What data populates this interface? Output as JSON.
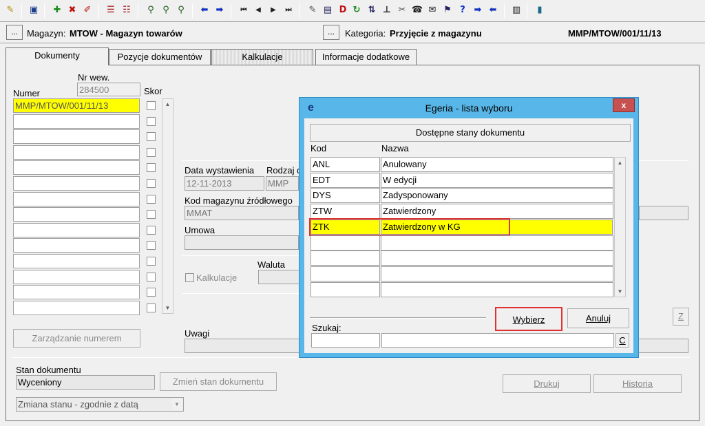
{
  "toolbar": {
    "icons": [
      "pin-icon",
      "save-icon",
      "add-icon",
      "delete-icon",
      "eraser-icon",
      "split-icon",
      "split2-icon",
      "binoculars-icon",
      "binoculars-next-icon",
      "binoculars-special-icon",
      "arrow-left-icon",
      "arrow-right-icon",
      "first-icon",
      "prev-icon",
      "next-icon",
      "last-icon",
      "edit-icon",
      "doc-icon",
      "doc-red-icon",
      "refresh-icon",
      "sort-icon",
      "tree-icon",
      "tools-icon",
      "phone-icon",
      "mail-icon",
      "filter-icon",
      "help-icon",
      "forward-icon",
      "back-icon",
      "report-icon",
      "exit-icon"
    ]
  },
  "header": {
    "magazyn_label": "Magazyn:",
    "magazyn_value": "MTOW - Magazyn towarów",
    "kategoria_label": "Kategoria:",
    "kategoria_value": "Przyjęcie z magazynu",
    "doc_number": "MMP/MTOW/001/11/13",
    "ellipsis": "..."
  },
  "tabs": [
    "Dokumenty",
    "Pozycje dokumentów",
    "Kalkulacje",
    "Informacje dodatkowe"
  ],
  "left": {
    "nr_wew_label": "Nr wew.",
    "nr_wew_value": "284500",
    "numer_label": "Numer",
    "skor_label": "Skor",
    "numer_rows": [
      "MMP/MTOW/001/11/13",
      "",
      "",
      "",
      "",
      "",
      "",
      "",
      "",
      "",
      "",
      "",
      "",
      ""
    ],
    "zarzadzanie_button": "Zarządzanie numerem"
  },
  "form": {
    "data_wystawienia_label": "Data wystawienia",
    "data_wystawienia_value": "12-11-2013",
    "rodzaj_label": "Rodzaj d",
    "rodzaj_value": "MMP",
    "kod_magazynu_label": "Kod magazynu źródłowego",
    "kod_magazynu_value": "MMAT",
    "umowa_label": "Umowa",
    "waluta_label": "Waluta",
    "kalkulacje_label": "Kalkulacje",
    "uwagi_label": "Uwagi",
    "z_button": "Z"
  },
  "status": {
    "stan_label": "Stan dokumentu",
    "stan_value": "Wyceniony",
    "zmien_button": "Zmień stan dokumentu",
    "zmiana_select": "Zmiana stanu - zgodnie z datą",
    "drukuj_button": "Drukuj",
    "historia_button": "Historia"
  },
  "dialog": {
    "title": "Egeria - lista wyboru",
    "logo": "e",
    "close": "x",
    "header_button": "Dostępne stany dokumentu",
    "col_kod": "Kod",
    "col_nazwa": "Nazwa",
    "rows": [
      {
        "kod": "ANL",
        "nazwa": "Anulowany"
      },
      {
        "kod": "EDT",
        "nazwa": "W edycji"
      },
      {
        "kod": "DYS",
        "nazwa": "Zadysponowany"
      },
      {
        "kod": "ZTW",
        "nazwa": "Zatwierdzony"
      },
      {
        "kod": "ZTK",
        "nazwa": "Zatwierdzony w KG"
      },
      {
        "kod": "",
        "nazwa": ""
      },
      {
        "kod": "",
        "nazwa": ""
      },
      {
        "kod": "",
        "nazwa": ""
      },
      {
        "kod": "",
        "nazwa": ""
      }
    ],
    "selected_index": 4,
    "wybierz_button": "Wybierz",
    "anuluj_button": "Anuluj",
    "szukaj_label": "Szukaj:",
    "c_button": "C",
    "highlight_color": "#e03030"
  }
}
